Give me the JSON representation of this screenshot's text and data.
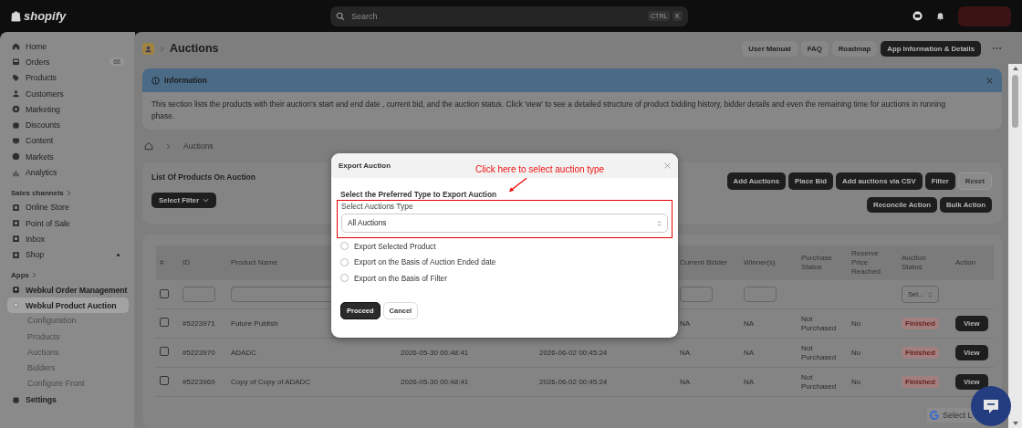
{
  "topbar": {
    "logo": "shopify",
    "search": {
      "placeholder": "Search"
    },
    "shortcut": [
      "CTRL",
      "K"
    ]
  },
  "sidebar": {
    "main": [
      {
        "label": "Home",
        "selected": false
      },
      {
        "label": "Orders",
        "badge": "68",
        "selected": false
      },
      {
        "label": "Products",
        "selected": false
      },
      {
        "label": "Customers",
        "selected": false
      },
      {
        "label": "Marketing",
        "selected": false
      },
      {
        "label": "Discounts",
        "selected": false
      },
      {
        "label": "Content",
        "selected": false
      },
      {
        "label": "Markets",
        "selected": false
      },
      {
        "label": "Analytics",
        "selected": false
      }
    ],
    "sales_channels": {
      "heading": "Sales channels",
      "items": [
        {
          "label": "Online Store",
          "selected": false
        },
        {
          "label": "Point of Sale",
          "selected": false
        },
        {
          "label": "Inbox",
          "selected": false
        },
        {
          "label": "Shop",
          "pinned": true,
          "selected": false
        }
      ]
    },
    "apps": {
      "heading": "Apps",
      "items": [
        {
          "label": "Webkul Order Management",
          "selected": false
        },
        {
          "label": "Webkul Product Auction",
          "selected": true,
          "children": [
            {
              "label": "Configuration"
            },
            {
              "label": "Products"
            },
            {
              "label": "Auctions"
            },
            {
              "label": "Bidders"
            },
            {
              "label": "Configure Front"
            }
          ]
        }
      ]
    },
    "settings": {
      "label": "Settings"
    }
  },
  "page": {
    "title": "Auctions",
    "header_buttons": [
      {
        "label": "User Manual",
        "primary": false
      },
      {
        "label": "FAQ",
        "primary": false
      },
      {
        "label": "Roadmap",
        "primary": false
      },
      {
        "label": "App Information & Details",
        "primary": true
      }
    ]
  },
  "info": {
    "title": "Information",
    "text": "This section lists the products with their auction's start and end date , current bid, and the auction status. Click 'view' to see a detailed structure of product bidding history, bidder details and even the remaining time for auctions in running phase."
  },
  "breadcrumb": {
    "current": "Auctions"
  },
  "list_card": {
    "title": "List Of Products On Auction",
    "filter_button": "Select Filter",
    "actions": [
      {
        "label": "Add Auctions",
        "primary": true
      },
      {
        "label": "Place Bid",
        "primary": true
      },
      {
        "label": "Add auctions via CSV",
        "primary": true
      },
      {
        "label": "Filter",
        "primary": true
      },
      {
        "label": "Reset",
        "primary": false
      }
    ],
    "actions_2": [
      {
        "label": "Reconcile Action",
        "primary": true
      },
      {
        "label": "Bulk Action",
        "primary": true
      }
    ]
  },
  "table": {
    "columns": [
      "#",
      "ID",
      "Product Name",
      null,
      null,
      "Current Bidder",
      "Winner(s)",
      "Purchase Status",
      "Reserve Price Reached",
      "Auction Status",
      "Action"
    ],
    "status_filter": "Sel...",
    "select_all_checked": false,
    "rows": [
      {
        "id": "#5223971",
        "name": "Future Publish",
        "start": null,
        "end": null,
        "bidder": "NA",
        "winner": "NA",
        "purchase": "Not Purchased",
        "reserve": "No",
        "status": "Finished",
        "action": "View",
        "checked": false
      },
      {
        "id": "#5223970",
        "name": "ADADC",
        "start": "2026-05-30 00:48:41",
        "end": "2026-06-02 00:45:24",
        "bidder": "NA",
        "winner": "NA",
        "purchase": "Not Purchased",
        "reserve": "No",
        "status": "Finished",
        "action": "View",
        "checked": false
      },
      {
        "id": "#5223969",
        "name": "Copy of Copy of ADADC",
        "start": "2026-05-30 00:48:41",
        "end": "2026-06-02 00:45:24",
        "bidder": "NA",
        "winner": "NA",
        "purchase": "Not Purchased",
        "reserve": "No",
        "status": "Finished",
        "action": "View",
        "checked": false
      }
    ]
  },
  "modal": {
    "title": "Export Auction",
    "heading": "Select the Preferred Type to Export Auction",
    "select_label": "Select Auctions Type",
    "select_value": "All Auctions",
    "options": [
      {
        "label": "Export Selected Product",
        "selected": false
      },
      {
        "label": "Export on the Basis of Auction Ended date",
        "selected": false
      },
      {
        "label": "Export on the Basis of Filter",
        "selected": false
      }
    ],
    "buttons": [
      {
        "label": "Proceed",
        "primary": true
      },
      {
        "label": "Cancel",
        "primary": false
      }
    ],
    "annotation": "Click here to select auction type"
  },
  "translate_widget": {
    "label": "Select L"
  }
}
